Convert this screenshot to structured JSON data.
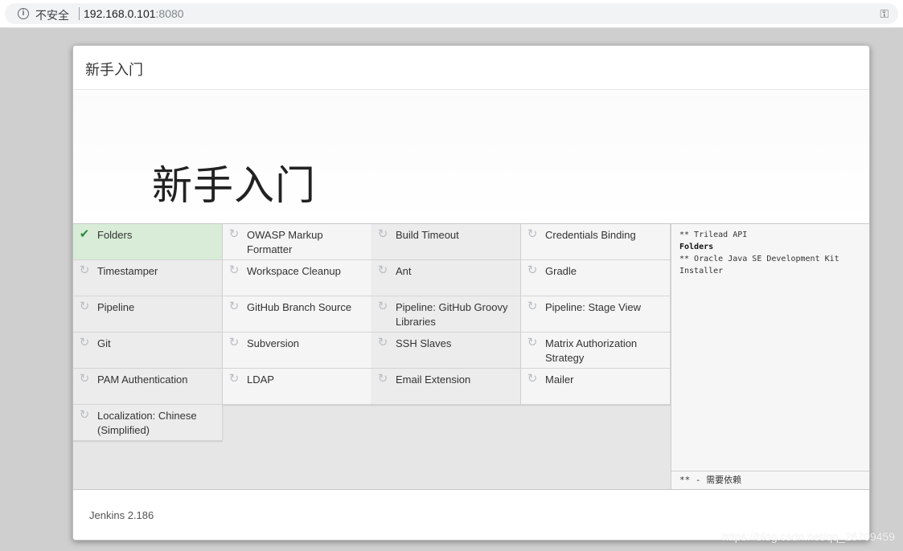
{
  "browser": {
    "security_label": "不安全",
    "url_host": "192.168.0.101",
    "url_port": ":8080",
    "info_icon": "info-icon",
    "key_icon": "key-icon"
  },
  "dialog": {
    "header_title": "新手入门",
    "hero_title": "新手入门",
    "progress_fraction": 0.025
  },
  "plugins": [
    {
      "label": "Folders",
      "status": "done"
    },
    {
      "label": "OWASP Markup Formatter",
      "status": "pending"
    },
    {
      "label": "Build Timeout",
      "status": "pending"
    },
    {
      "label": "Credentials Binding",
      "status": "pending"
    },
    {
      "label": "Timestamper",
      "status": "pending"
    },
    {
      "label": "Workspace Cleanup",
      "status": "pending"
    },
    {
      "label": "Ant",
      "status": "pending"
    },
    {
      "label": "Gradle",
      "status": "pending"
    },
    {
      "label": "Pipeline",
      "status": "pending"
    },
    {
      "label": "GitHub Branch Source",
      "status": "pending"
    },
    {
      "label": "Pipeline: GitHub Groovy Libraries",
      "status": "pending"
    },
    {
      "label": "Pipeline: Stage View",
      "status": "pending"
    },
    {
      "label": "Git",
      "status": "pending"
    },
    {
      "label": "Subversion",
      "status": "pending"
    },
    {
      "label": "SSH Slaves",
      "status": "pending"
    },
    {
      "label": "Matrix Authorization Strategy",
      "status": "pending"
    },
    {
      "label": "PAM Authentication",
      "status": "pending"
    },
    {
      "label": "LDAP",
      "status": "pending"
    },
    {
      "label": "Email Extension",
      "status": "pending"
    },
    {
      "label": "Mailer",
      "status": "pending"
    },
    {
      "label": "Localization: Chinese (Simplified)",
      "status": "pending"
    }
  ],
  "deps": {
    "lines": [
      "** Trilead API",
      "Folders",
      "** Oracle Java SE Development Kit Installer"
    ],
    "footer": "** - 需要依赖"
  },
  "footer": {
    "version": "Jenkins 2.186"
  },
  "watermark": "https://blog.csdn.net/qq_26709459",
  "colors": {
    "done_bg": "#d8ecd8",
    "check": "#2e8b3e",
    "progress": "#2a6fb5"
  }
}
